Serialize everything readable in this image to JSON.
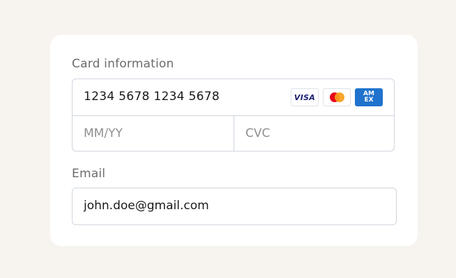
{
  "form": {
    "card_label": "Card information",
    "card_number_value": "1234 5678 1234 5678",
    "expiry_placeholder": "MM/YY",
    "cvc_placeholder": "CVC",
    "email_label": "Email",
    "email_value": "john.doe@gmail.com"
  },
  "brands": {
    "visa": "VISA",
    "amex_top": "AM",
    "amex_bottom": "EX",
    "icons": [
      "visa-icon",
      "mastercard-icon",
      "amex-icon"
    ]
  },
  "colors": {
    "background": "#f7f4ef",
    "card": "#ffffff",
    "border": "#cfd6de",
    "text": "#1a1a1a",
    "label": "#6b6b6b",
    "placeholder": "#8f8f8f",
    "visa": "#1a1f71",
    "mastercard_red": "#eb001b",
    "mastercard_yellow": "#f79e1b",
    "amex": "#1f72cd"
  }
}
